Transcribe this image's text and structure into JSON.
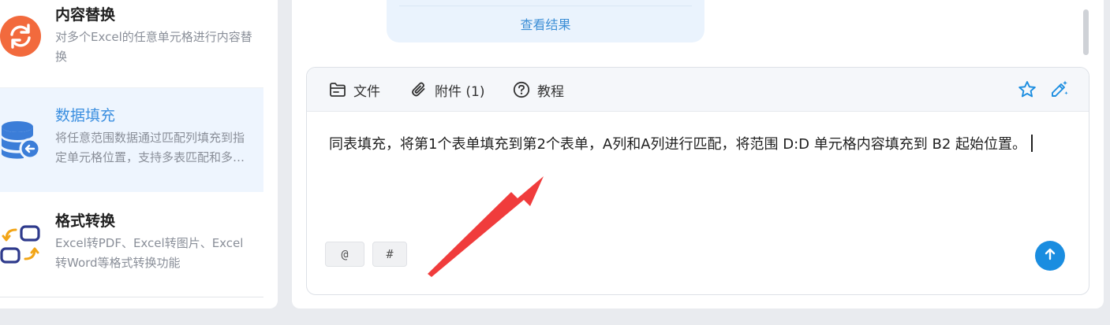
{
  "sidebar": {
    "items": [
      {
        "title": "内容替换",
        "description": "对多个Excel的任意单元格进行内容替换",
        "icon": "refresh-icon",
        "icon_color": "#f26a3d"
      },
      {
        "title": "数据填充",
        "description": "将任意范围数据通过匹配列填充到指定单元格位置，支持多表匹配和多种填充方式",
        "icon": "database-fill-icon",
        "icon_color": "#3b7dd8",
        "selected": true
      },
      {
        "title": "格式转换",
        "description": "Excel转PDF、Excel转图片、Excel转Word等格式转换功能",
        "icon": "convert-icon",
        "icon_color": "#2e3a8c"
      }
    ]
  },
  "chat": {
    "result_link": "查看结果"
  },
  "composer": {
    "toolbar": {
      "file_label": "文件",
      "attachment_label": "附件 (1)",
      "tutorial_label": "教程"
    },
    "text": "同表填充，将第1个表单填充到第2个表单，A列和A列进行匹配，将范围 D:D 单元格内容填充到 B2 起始位置。",
    "mention_chip": "@",
    "hash_chip": "#"
  },
  "colors": {
    "accent": "#1a8de0",
    "selected_bg": "#eef5fe",
    "annotation_arrow": "#f03c3c"
  }
}
